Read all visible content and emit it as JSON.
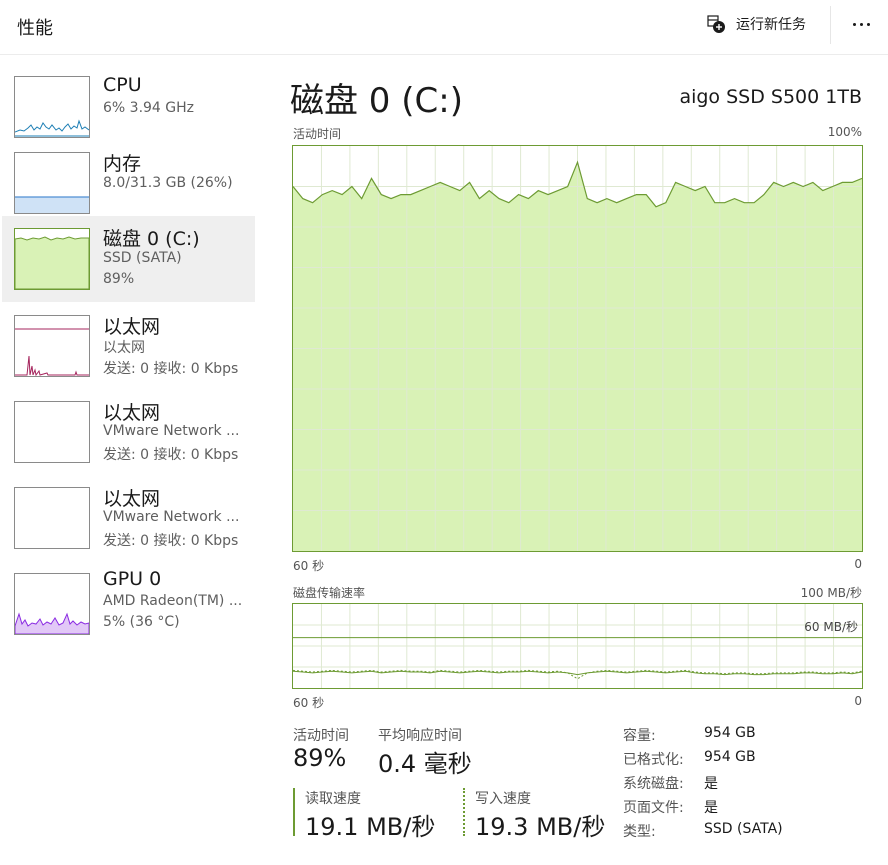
{
  "header": {
    "title": "性能",
    "run_new_task": "运行新任务",
    "more_icon": "more-horizontal-icon",
    "run_icon": "run-task-icon"
  },
  "sidebar": {
    "items": [
      {
        "title": "CPU",
        "line1": "6% 3.94 GHz",
        "line2": "",
        "graph": "cpu",
        "selected": false
      },
      {
        "title": "内存",
        "line1": "8.0/31.3 GB (26%)",
        "line2": "",
        "graph": "memory",
        "selected": false
      },
      {
        "title": "磁盘 0 (C:)",
        "line1": "SSD (SATA)",
        "line2": "89%",
        "graph": "disk",
        "selected": true
      },
      {
        "title": "以太网",
        "line1": "以太网",
        "line2": "发送: 0 接收: 0 Kbps",
        "graph": "ethernet",
        "selected": false
      },
      {
        "title": "以太网",
        "line1": "VMware Network ...",
        "line2": "发送: 0 接收: 0 Kbps",
        "graph": "empty",
        "selected": false
      },
      {
        "title": "以太网",
        "line1": "VMware Network ...",
        "line2": "发送: 0 接收: 0 Kbps",
        "graph": "empty",
        "selected": false
      },
      {
        "title": "GPU 0",
        "line1": "AMD Radeon(TM) ...",
        "line2": "5% (36 °C)",
        "graph": "gpu",
        "selected": false
      }
    ]
  },
  "disk": {
    "title": "磁盘 0 (C:)",
    "model": "aigo SSD S500 1TB",
    "activity_graph": {
      "label": "活动时间",
      "max_label": "100%",
      "time_left": "60 秒",
      "time_right": "0",
      "series_percent": [
        90,
        87,
        86,
        88,
        89,
        88,
        90,
        87,
        92,
        88,
        87,
        88,
        88,
        89,
        90,
        91,
        90,
        89,
        91,
        87,
        89,
        87,
        86,
        88,
        87,
        89,
        88,
        89,
        90,
        96,
        87,
        86,
        87,
        86,
        87,
        88,
        88,
        85,
        86,
        91,
        90,
        89,
        90,
        86,
        86,
        87,
        86,
        86,
        88,
        91,
        90,
        91,
        90,
        91,
        89,
        90,
        91,
        91,
        92
      ]
    },
    "transfer_graph": {
      "label": "磁盘传输速率",
      "max_label": "100 MB/秒",
      "ref_label": "60 MB/秒",
      "time_left": "60 秒",
      "time_right": "0",
      "read_series_mbps": [
        20,
        19,
        18,
        19,
        20,
        19,
        18,
        19,
        20,
        18,
        19,
        20,
        19,
        19,
        18,
        20,
        19,
        18,
        19,
        20,
        19,
        18,
        19,
        19,
        20,
        19,
        18,
        19,
        18,
        16,
        18,
        19,
        20,
        19,
        18,
        19,
        20,
        19,
        18,
        19,
        20,
        18,
        17,
        17,
        16,
        17,
        17,
        16,
        16,
        17,
        17,
        17,
        18,
        18,
        17,
        17,
        18,
        17,
        19
      ],
      "write_series_mbps": [
        21,
        20,
        19,
        20,
        21,
        20,
        19,
        20,
        21,
        19,
        20,
        21,
        20,
        20,
        19,
        21,
        20,
        19,
        20,
        21,
        20,
        19,
        20,
        20,
        21,
        20,
        19,
        20,
        18,
        11,
        18,
        20,
        21,
        20,
        19,
        20,
        21,
        20,
        19,
        20,
        21,
        19,
        18,
        18,
        17,
        18,
        18,
        17,
        17,
        18,
        18,
        18,
        19,
        19,
        18,
        18,
        19,
        18,
        20
      ]
    },
    "stats": {
      "active_label": "活动时间",
      "active_value": "89%",
      "response_label": "平均响应时间",
      "response_value": "0.4 毫秒",
      "read_label": "读取速度",
      "read_value": "19.1 MB/秒",
      "write_label": "写入速度",
      "write_value": "19.3 MB/秒"
    },
    "properties": {
      "capacity_label": "容量:",
      "capacity_value": "954 GB",
      "formatted_label": "已格式化:",
      "formatted_value": "954 GB",
      "system_label": "系统磁盘:",
      "system_value": "是",
      "pagefile_label": "页面文件:",
      "pagefile_value": "是",
      "type_label": "类型:",
      "type_value": "SSD (SATA)"
    }
  },
  "colors": {
    "accent_green": "#6d9b33",
    "fill_green": "#d9f2b6",
    "grid": "#dfe9d2",
    "cpu_blue": "#1e7fb5",
    "memory_blue": "#4f8fd4",
    "ethernet_pink": "#a5245c",
    "gpu_purple": "#8a2be2"
  }
}
